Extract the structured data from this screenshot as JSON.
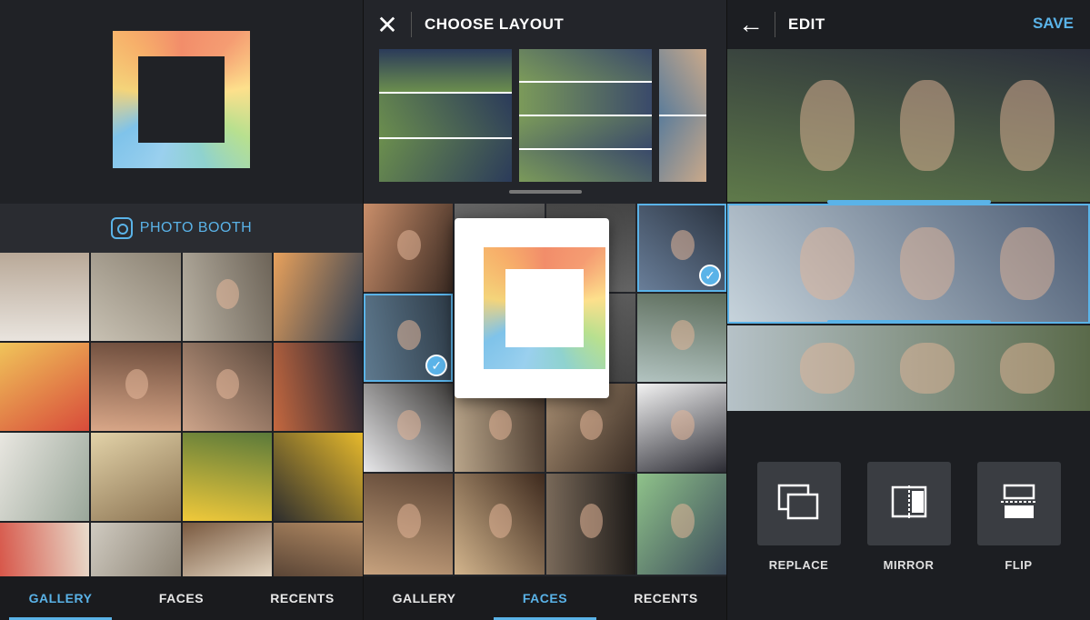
{
  "colors": {
    "accent": "#5ab3e8",
    "background": "#1f2125",
    "tab_bar": "#1a1b1e"
  },
  "panel1": {
    "photo_booth_label": "PHOTO BOOTH",
    "photos": [
      {
        "desc": "bulldog on tiled floor",
        "c1": "#e9e4de",
        "c2": "#b9a998"
      },
      {
        "desc": "rocky coastline",
        "c1": "#c8c1b3",
        "c2": "#8a8172"
      },
      {
        "desc": "person sitting on rocks",
        "c1": "#b9b2a4",
        "c2": "#6d6458"
      },
      {
        "desc": "sunset over water",
        "c1": "#e8a15c",
        "c2": "#2b3c52"
      },
      {
        "desc": "balloons",
        "c1": "#f0c45a",
        "c2": "#d84b3a"
      },
      {
        "desc": "smiling girl selfie",
        "c1": "#d9a788",
        "c2": "#6b4b3b"
      },
      {
        "desc": "two girls selfie",
        "c1": "#cda48a",
        "c2": "#5d4a3e"
      },
      {
        "desc": "palm trees at dusk",
        "c1": "#c5683f",
        "c2": "#1c2232"
      },
      {
        "desc": "white house window",
        "c1": "#e8e6e0",
        "c2": "#9aa79a"
      },
      {
        "desc": "pastries in box",
        "c1": "#e2d2a8",
        "c2": "#8b7352"
      },
      {
        "desc": "yellow flowers",
        "c1": "#f0c93a",
        "c2": "#5b7a3a"
      },
      {
        "desc": "bicycle with yellow leaves",
        "c1": "#2d2d2d",
        "c2": "#e6b92c"
      },
      {
        "desc": "coffee cup",
        "c1": "#d7574a",
        "c2": "#e8dccc"
      },
      {
        "desc": "sidewalk",
        "c1": "#cfcac0",
        "c2": "#8d8475"
      },
      {
        "desc": "puppy",
        "c1": "#7a5a40",
        "c2": "#e2d4c0"
      },
      {
        "desc": "dog on porch",
        "c1": "#5a4536",
        "c2": "#b28a63"
      }
    ],
    "tabs": [
      {
        "label": "GALLERY",
        "active": true
      },
      {
        "label": "FACES",
        "active": false
      },
      {
        "label": "RECENTS",
        "active": false
      }
    ]
  },
  "panel2": {
    "title": "CHOOSE LAYOUT",
    "layouts": [
      {
        "desc": "three-row layout",
        "c1": "#6b8e4e",
        "c2": "#2b3b5a"
      },
      {
        "desc": "four-row layout",
        "c1": "#7b9a5a",
        "c2": "#3a4a6a"
      },
      {
        "desc": "two-row layout",
        "c1": "#5d7d9a",
        "c2": "#caa98a"
      }
    ],
    "photos": [
      {
        "desc": "girls selfie",
        "c1": "#c98e6a",
        "c2": "#3a2a22",
        "selected": false
      },
      {
        "desc": "",
        "c1": "#666",
        "c2": "#444",
        "selected": false
      },
      {
        "desc": "",
        "c1": "#666",
        "c2": "#444",
        "selected": false
      },
      {
        "desc": "two girls with flannel",
        "c1": "#6a7f9a",
        "c2": "#2a3340",
        "selected": true
      },
      {
        "desc": "girls lying in grass",
        "c1": "#5f7a8f",
        "c2": "#2d3a46",
        "selected": true
      },
      {
        "desc": "",
        "c1": "#666",
        "c2": "#444",
        "selected": false
      },
      {
        "desc": "",
        "c1": "#666",
        "c2": "#444",
        "selected": false
      },
      {
        "desc": "friends on field",
        "c1": "#b2c3c0",
        "c2": "#5b6b5a",
        "selected": false
      },
      {
        "desc": "girl in white shirt",
        "c1": "#e8e8ea",
        "c2": "#3c3a38",
        "selected": false
      },
      {
        "desc": "group selfie",
        "c1": "#b9a58a",
        "c2": "#4a3a2e",
        "selected": false
      },
      {
        "desc": "group selfie 2",
        "c1": "#a88e72",
        "c2": "#3a2d24",
        "selected": false
      },
      {
        "desc": "guy with glasses",
        "c1": "#f2f2f2",
        "c2": "#2b2b33",
        "selected": false
      },
      {
        "desc": "girl with phone",
        "c1": "#c7a27e",
        "c2": "#5b4333",
        "selected": false
      },
      {
        "desc": "girl laughing",
        "c1": "#d2b48c",
        "c2": "#3e2a1e",
        "selected": false
      },
      {
        "desc": "group at night",
        "c1": "#7a6a5a",
        "c2": "#1d1a18",
        "selected": false
      },
      {
        "desc": "two girls green wall",
        "c1": "#8fc28a",
        "c2": "#3b4a5a",
        "selected": false
      }
    ],
    "tabs": [
      {
        "label": "GALLERY",
        "active": false
      },
      {
        "label": "FACES",
        "active": true
      },
      {
        "label": "RECENTS",
        "active": false
      }
    ]
  },
  "panel3": {
    "title": "EDIT",
    "save_label": "SAVE",
    "strips": [
      {
        "desc": "girls lying in grass",
        "c1": "#5f7a4a",
        "c2": "#2a2e3a",
        "selected": false
      },
      {
        "desc": "friends hugging outdoors",
        "c1": "#c7d4dc",
        "c2": "#4a5a72",
        "selected": true
      },
      {
        "desc": "girls selfie on field",
        "c1": "#b6c2c8",
        "c2": "#5a6a4a",
        "selected": false
      }
    ],
    "tools": [
      {
        "label": "REPLACE",
        "icon": "replace-icon"
      },
      {
        "label": "MIRROR",
        "icon": "mirror-icon"
      },
      {
        "label": "FLIP",
        "icon": "flip-icon"
      }
    ]
  }
}
